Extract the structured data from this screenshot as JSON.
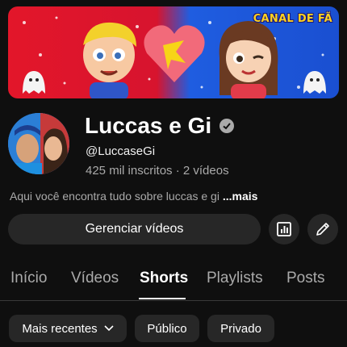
{
  "banner": {
    "caption": "CANAL DE FÃ"
  },
  "channel": {
    "name": "Luccas e Gi",
    "handle": "@LuccaseGi",
    "stats": "425 mil inscritos · 2 vídeos",
    "description": "Aqui você encontra tudo sobre luccas e gi ",
    "more_label": "...mais"
  },
  "actions": {
    "manage_label": "Gerenciar vídeos",
    "analytics_icon": "analytics-icon",
    "edit_icon": "pencil-icon"
  },
  "tabs": [
    {
      "label": "Início"
    },
    {
      "label": "Vídeos"
    },
    {
      "label": "Shorts",
      "active": true
    },
    {
      "label": "Playlists"
    },
    {
      "label": "Posts"
    }
  ],
  "filters": {
    "sort_label": "Mais recentes",
    "public_label": "Público",
    "private_label": "Privado"
  },
  "colors": {
    "background": "#0f0f0f",
    "chip": "#272727",
    "banner_left": "#e3162a",
    "banner_right": "#1f5de0",
    "caption": "#ffd21f"
  }
}
